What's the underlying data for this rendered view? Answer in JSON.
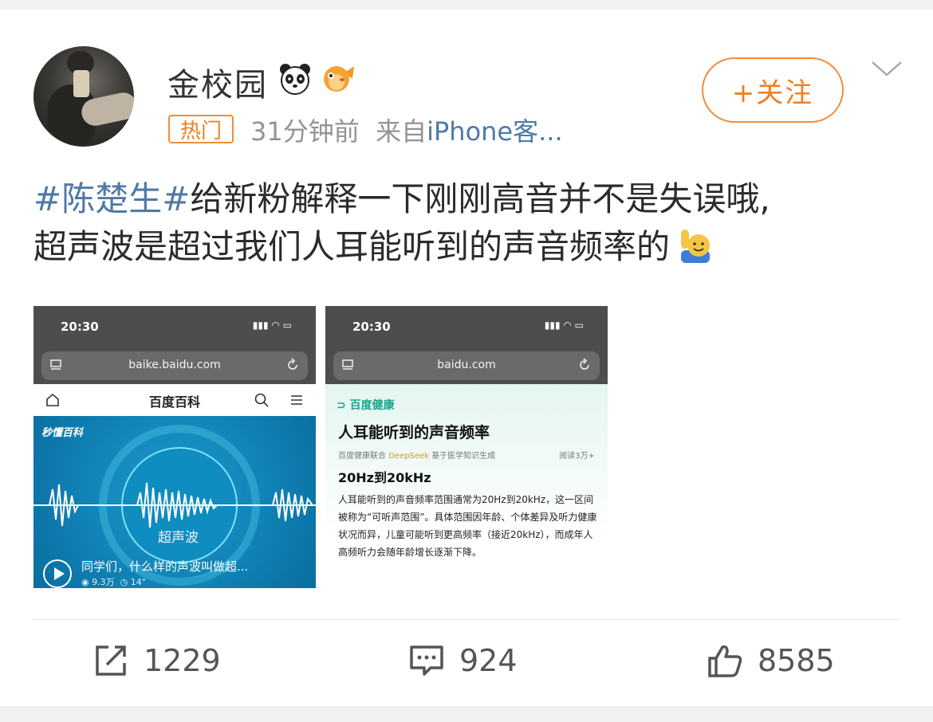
{
  "post": {
    "username": "金校园",
    "follow_label": "+关注",
    "hot_badge": "热门",
    "time": "31分钟前",
    "source_prefix": "来自",
    "source": "iPhone客...",
    "hashtag": "#陈楚生#",
    "text_line1": "给新粉解释一下刚刚高音并不是失误哦,",
    "text_line2": "超声波是超过我们人耳能听到的声音频率的"
  },
  "images": [
    {
      "status_time": "20:30",
      "url": "baike.baidu.com",
      "nav_title": "百度百科",
      "brand": "秒懂百科",
      "caption": "超声波",
      "video_title": "同学们，什么样的声波叫做超...",
      "views": "9.3万",
      "duration": "14\""
    },
    {
      "status_time": "20:30",
      "url": "baidu.com",
      "logo": "百度健康",
      "title": "人耳能听到的声音频率",
      "sub_prefix": "百度健康联合",
      "sub_deepseek": "DeepSeek",
      "sub_suffix": "基于医学知识生成",
      "reads": "阅读3万+",
      "heading": "20Hz到20kHz",
      "body": "人耳能听到的声音频率范围通常为20Hz到20kHz，这一区间被称为“可听声范围”。具体范围因年龄、个体差异及听力健康状况而异，儿童可能听到更高频率（接近20kHz），而成年人高频听力会随年龄增长逐渐下降。"
    }
  ],
  "actions": {
    "reposts": "1229",
    "comments": "924",
    "likes": "8585"
  },
  "colors": {
    "accent_orange": "#f07f1e",
    "link_blue": "#4f7aa7",
    "meta_gray": "#939393"
  },
  "icons": [
    "panda-emoji-icon",
    "pufferfish-emoji-icon",
    "raised-hand-emoji-icon",
    "chevron-down-icon",
    "repost-icon",
    "comment-icon",
    "like-icon"
  ]
}
